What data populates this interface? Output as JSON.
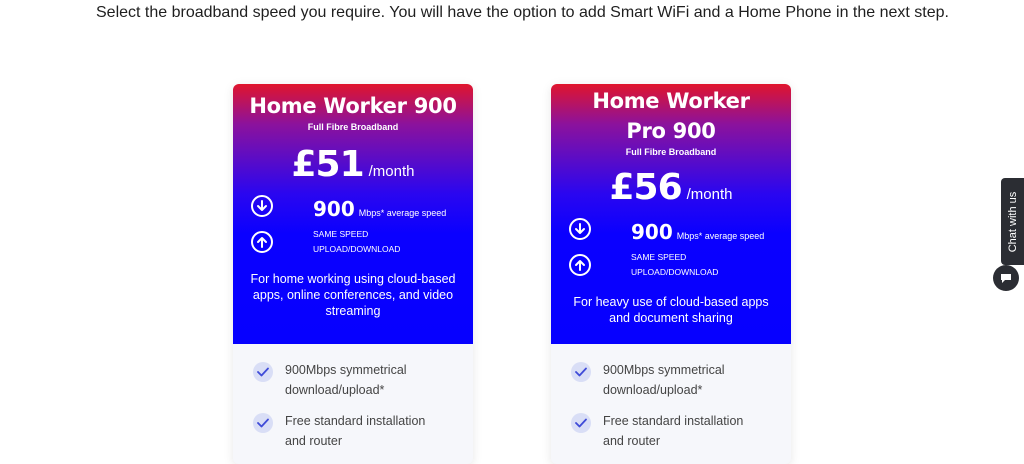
{
  "intro": "Select the broadband speed you require. You will have the option to add Smart WiFi and a Home Phone in the next step.",
  "plans": [
    {
      "title": "Home Worker 900",
      "subtitle": "Full Fibre Broadband",
      "price": "£51",
      "per": "/month",
      "speed": "900",
      "speed_label": "Mbps* average speed",
      "same_speed_line1": "SAME SPEED",
      "same_speed_line2": "UPLOAD/DOWNLOAD",
      "description": "For home working using cloud-based apps, online conferences, and video streaming",
      "features": [
        "900Mbps symmetrical download/upload*",
        "Free standard installation and router"
      ]
    },
    {
      "title": "Home Worker Pro 900",
      "subtitle": "Full Fibre Broadband",
      "price": "£56",
      "per": "/month",
      "speed": "900",
      "speed_label": "Mbps* average speed",
      "same_speed_line1": "SAME SPEED",
      "same_speed_line2": "UPLOAD/DOWNLOAD",
      "description": "For heavy use of cloud-based apps and document sharing",
      "features": [
        "900Mbps symmetrical download/upload*",
        "Free standard installation and router"
      ]
    }
  ],
  "icons": {
    "download": "arrow-down-circle-icon",
    "upload": "arrow-up-circle-icon",
    "check": "check-icon",
    "chat": "chat-bubble-icon"
  },
  "chat": {
    "label": "Chat with us"
  },
  "colors": {
    "gradient_top": "#e0152d",
    "gradient_bottom": "#0600ff",
    "check_bg": "#d9def6"
  }
}
